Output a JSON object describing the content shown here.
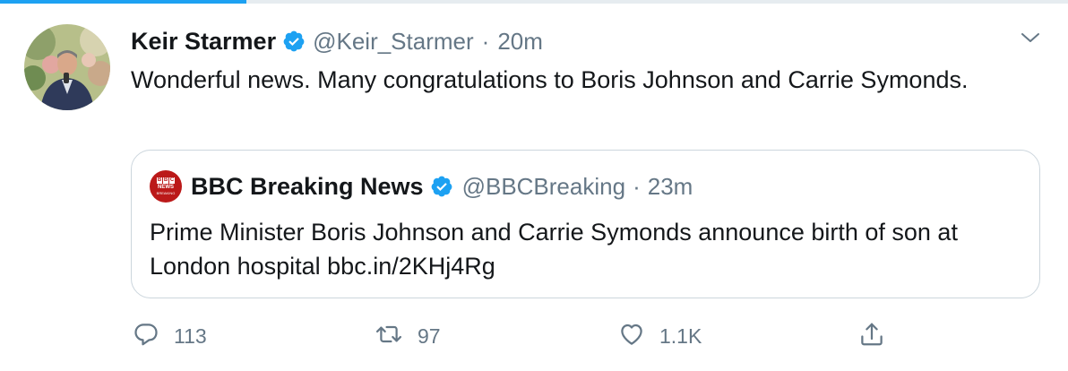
{
  "tweet": {
    "author_name": "Keir Starmer",
    "author_handle": "@Keir_Starmer",
    "separator": "·",
    "time": "20m",
    "text": "Wonderful news. Many congratulations to Boris Johnson and Carrie Symonds.",
    "verified": true
  },
  "quoted": {
    "author_name": "BBC Breaking News",
    "author_handle": "@BBCBreaking",
    "separator": "·",
    "time": "23m",
    "text": "Prime Minister Boris Johnson and Carrie Symonds announce birth of son at London hospital bbc.in/2KHj4Rg",
    "logo": {
      "b1": "B",
      "b2": "B",
      "b3": "C",
      "line1": "NEWS",
      "line2": "BREAKING"
    },
    "verified": true
  },
  "actions": {
    "reply_count": "113",
    "retweet_count": "97",
    "like_count": "1.1K"
  },
  "icons": {
    "caret": "chevron-down-icon",
    "reply": "reply-icon",
    "retweet": "retweet-icon",
    "like": "heart-icon",
    "share": "share-icon",
    "verified": "verified-badge-icon"
  },
  "colors": {
    "accent": "#1da1f2",
    "secondary_text": "#657786",
    "bbc_red": "#bb1919"
  }
}
